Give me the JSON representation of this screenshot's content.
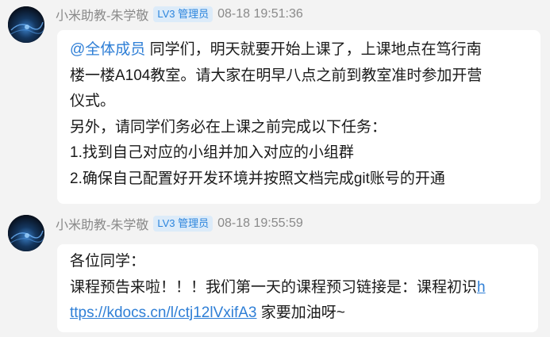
{
  "messages": [
    {
      "sender": "小米助教-朱学敬",
      "badge": "LV3 管理员",
      "time": "08-18 19:51:36",
      "mention": "@全体成员",
      "lines": [
        " 同学们，明天就要开始上课了，上课地点在笃行南",
        "楼一楼A104教室。请大家在明早八点之前到教室准时参加开营",
        "仪式。",
        "另外，请同学们务必在上课之前完成以下任务：",
        "1.找到自己对应的小组并加入对应的小组群",
        "2.确保自己配置好开发环境并按照文档完成git账号的开通"
      ]
    },
    {
      "sender": "小米助教-朱学敬",
      "badge": "LV3 管理员",
      "time": "08-18 19:55:59",
      "line1": "各位同学：",
      "line2_text": "课程预告来啦！！！我们第一天的课程预习链接是：课程初识",
      "link_part1": "h",
      "link_part2": "ttps://kdocs.cn/l/ctj12lVxifA3",
      "line3_tail": " 家要加油呀~"
    }
  ],
  "colors": {
    "background": "#f3f3f3",
    "bubble": "#ffffff",
    "link": "#2f7fd6",
    "badge_bg": "#dcebf9",
    "badge_text": "#2c85dd",
    "meta_text": "#8a8a8a"
  }
}
